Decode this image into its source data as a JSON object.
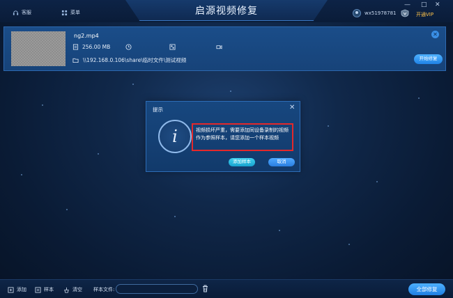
{
  "window": {
    "title": "启源视频修复",
    "vip_link": "开通VIP",
    "controls": {
      "minimize": "—",
      "maximize": "□",
      "close": "✕"
    }
  },
  "nav": {
    "items": [
      {
        "label": "客服",
        "icon": "headset-icon"
      },
      {
        "label": "菜单",
        "icon": "menu-icon"
      }
    ]
  },
  "user": {
    "name": "wx51978781"
  },
  "file_card": {
    "file_name": "ng2.mp4",
    "file_size": "256.00 MB",
    "path": "\\\\192.168.0.106\\share\\临时文件\\测试视频",
    "start_button": "开始修复",
    "close_glyph": "✕"
  },
  "dialog": {
    "title": "提示",
    "close_glyph": "✕",
    "icon_glyph": "i",
    "message": "视频损坏严重，需要添加同设备录制的视频作为参照样本，请您添加一个样本视频",
    "add_sample_button": "添加样本",
    "cancel_button": "取消"
  },
  "bottom_bar": {
    "add_label": "添加",
    "sample_label": "样本",
    "clear_label": "清空",
    "sample_file_label": "样本文件:",
    "sample_file_value": "",
    "repair_all_button": "全部修复"
  },
  "colors": {
    "accent": "#2e8cf0",
    "highlight_border": "#e5282a",
    "vip": "#ffc44a",
    "background": "#0f2747"
  }
}
